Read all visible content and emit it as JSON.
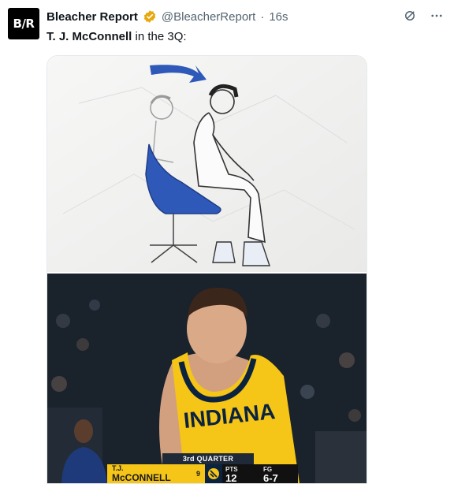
{
  "account": {
    "avatar_text": "B/R",
    "name": "Bleacher Report",
    "handle": "@BleacherReport",
    "separator": "·",
    "time": "16s"
  },
  "tweet": {
    "text_bold": "T. J. McConnell",
    "text_rest": " in the 3Q:"
  },
  "scorebug": {
    "quarter": "3rd QUARTER",
    "player_label": "T.J.",
    "player_name": "McCONNELL",
    "player_number": "9",
    "stats": [
      {
        "label": "PTS",
        "value": "12"
      },
      {
        "label": "FG",
        "value": "6-7"
      }
    ]
  },
  "jersey": {
    "text": "INDIANA"
  },
  "colors": {
    "accent_verified": "#e8a80c",
    "pacers_yellow": "#f5c518",
    "pacers_navy": "#0c2340",
    "chair_blue": "#2f59b8"
  },
  "icons": [
    "grok-icon",
    "more-icon",
    "verified-badge-icon"
  ]
}
